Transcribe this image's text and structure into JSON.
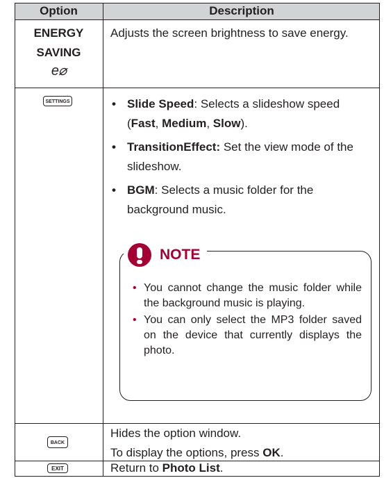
{
  "header": {
    "col1": "Option",
    "col2": "Description"
  },
  "rows": [
    {
      "option_line1": "ENERGY",
      "option_line2": "SAVING",
      "option_icon": "eco-icon",
      "option_icon_glyph": "e⌀",
      "description": "Adjusts the screen brightness to save energy."
    },
    {
      "option_icon": "settings-key-icon",
      "option_icon_text": "SETTINGS",
      "bullets": [
        {
          "term": "Slide Speed",
          "text_a": ": Selects a slideshow speed (",
          "b1": "Fast",
          "sep1": ", ",
          "b2": "Medium",
          "sep2": ", ",
          "b3": "Slow",
          "text_b": ")."
        },
        {
          "term": "TransitionEffect:",
          "text": " Set the view mode of the slideshow."
        },
        {
          "term": "BGM",
          "text": ": Selects a music folder for the background music."
        }
      ],
      "note": {
        "title": "NOTE",
        "items": [
          "You cannot change the music folder while the background music is playing.",
          "You can only select the MP3 folder saved on the device that currently displays the photo."
        ]
      }
    },
    {
      "option_icon": "back-key-icon",
      "option_icon_text": "BACK",
      "line1": "Hides the option window.",
      "line2_pre": "To display the options, press ",
      "line2_bold": "OK",
      "line2_post": "."
    },
    {
      "option_icon": "exit-key-icon",
      "option_icon_text": "EXIT",
      "desc_pre": "Return to ",
      "desc_bold": "Photo List",
      "desc_post": "."
    }
  ],
  "colors": {
    "header_bg": "#d1d3d4",
    "note_accent": "#a50034",
    "text": "#231f20"
  }
}
